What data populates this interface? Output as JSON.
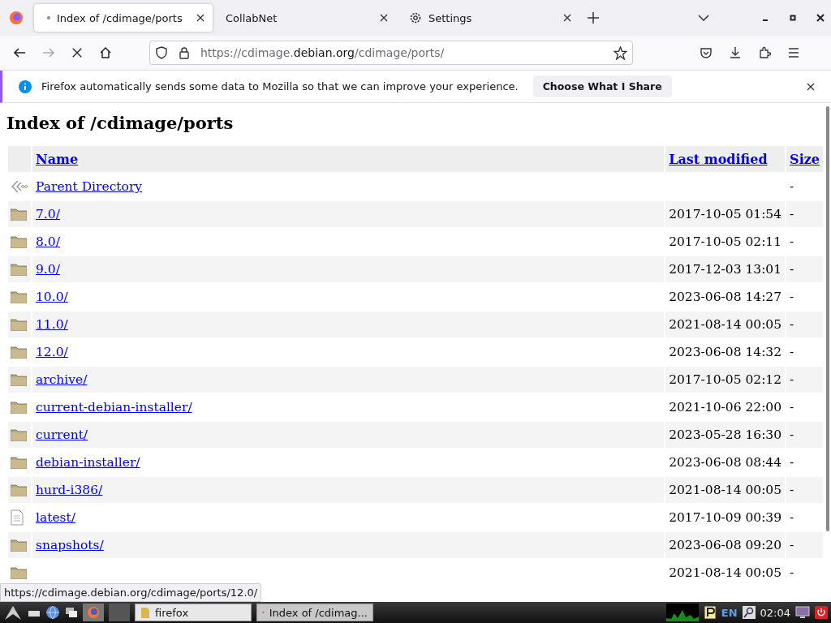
{
  "tabs": [
    {
      "title": "Index of /cdimage/ports",
      "selected": true
    },
    {
      "title": "CollabNet",
      "selected": false
    },
    {
      "title": "Settings",
      "selected": false
    }
  ],
  "address": {
    "prefix": "https://cdimage.",
    "domain": "debian.org",
    "path": "/cdimage/ports/"
  },
  "notification": {
    "message": "Firefox automatically sends some data to Mozilla so that we can improve your experience.",
    "button": "Choose What I Share"
  },
  "page": {
    "title": "Index of /cdimage/ports",
    "columns": [
      "Name",
      "Last modified",
      "Size"
    ],
    "rows": [
      {
        "kind": "parent",
        "name": "Parent Directory",
        "modified": "",
        "size": "-"
      },
      {
        "kind": "folder",
        "name": "7.0/",
        "modified": "2017-10-05 01:54",
        "size": "-"
      },
      {
        "kind": "folder",
        "name": "8.0/",
        "modified": "2017-10-05 02:11",
        "size": "-"
      },
      {
        "kind": "folder",
        "name": "9.0/",
        "modified": "2017-12-03 13:01",
        "size": "-"
      },
      {
        "kind": "folder",
        "name": "10.0/",
        "modified": "2023-06-08 14:27",
        "size": "-"
      },
      {
        "kind": "folder",
        "name": "11.0/",
        "modified": "2021-08-14 00:05",
        "size": "-"
      },
      {
        "kind": "folder",
        "name": "12.0/",
        "modified": "2023-06-08 14:32",
        "size": "-"
      },
      {
        "kind": "folder",
        "name": "archive/",
        "modified": "2017-10-05 02:12",
        "size": "-"
      },
      {
        "kind": "folder",
        "name": "current-debian-installer/",
        "modified": "2021-10-06 22:00",
        "size": "-"
      },
      {
        "kind": "folder",
        "name": "current/",
        "modified": "2023-05-28 16:30",
        "size": "-"
      },
      {
        "kind": "folder",
        "name": "debian-installer/",
        "modified": "2023-06-08 08:44",
        "size": "-"
      },
      {
        "kind": "folder",
        "name": "hurd-i386/",
        "modified": "2021-08-14 00:05",
        "size": "-"
      },
      {
        "kind": "file",
        "name": "latest/",
        "modified": "2017-10-09 00:39",
        "size": "-"
      },
      {
        "kind": "folder",
        "name": "snapshots/",
        "modified": "2023-06-08 09:20",
        "size": "-"
      },
      {
        "kind": "folder",
        "name": "",
        "modified": "2021-08-14 00:05",
        "size": "-"
      }
    ]
  },
  "status_url": "https://cdimage.debian.org/cdimage/ports/12.0/",
  "taskbar": {
    "windows": [
      {
        "title": "firefox",
        "selected": false
      },
      {
        "title": "Index of /cdimag...",
        "selected": true
      }
    ],
    "language": "EN",
    "clock": "02:04"
  }
}
